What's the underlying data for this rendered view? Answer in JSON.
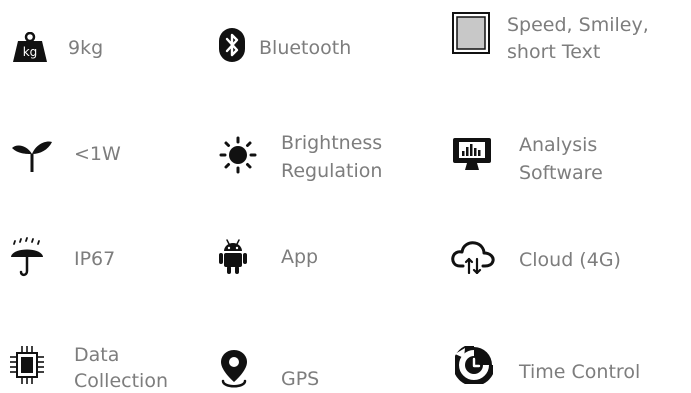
{
  "features": [
    {
      "icon": "weight-kg-icon",
      "label": "9kg",
      "badge": "kg"
    },
    {
      "icon": "bluetooth-icon",
      "label": "Bluetooth"
    },
    {
      "icon": "display-panel-icon",
      "line1": "Speed, Smiley,",
      "line2": "short Text"
    },
    {
      "icon": "seedling-icon",
      "label": "<1W"
    },
    {
      "icon": "brightness-icon",
      "line1": "Brightness",
      "line2": "Regulation"
    },
    {
      "icon": "analysis-monitor-icon",
      "line1": "Analysis",
      "line2": "Software"
    },
    {
      "icon": "umbrella-rain-icon",
      "label": "IP67"
    },
    {
      "icon": "android-icon",
      "label": "App"
    },
    {
      "icon": "cloud-transfer-icon",
      "label": "Cloud (4G)"
    },
    {
      "icon": "chip-icon",
      "line1": "Data",
      "line2": "Collection"
    },
    {
      "icon": "location-pin-icon",
      "label": "GPS"
    },
    {
      "icon": "time-control-icon",
      "label": "Time Control"
    }
  ]
}
